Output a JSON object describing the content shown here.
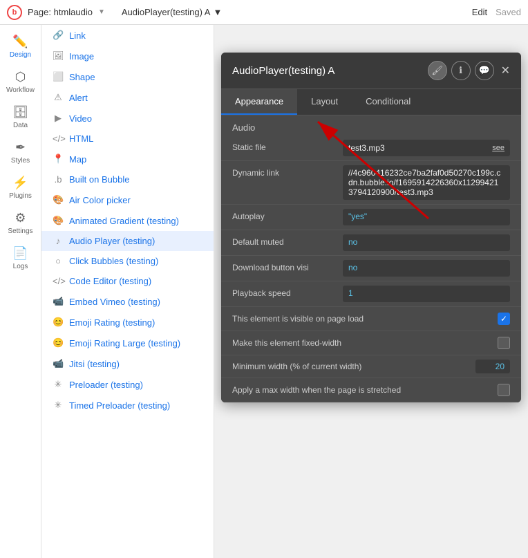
{
  "topbar": {
    "logo": "b",
    "page_label": "Page: htmlaudio",
    "dropdown_arrow": "▼",
    "element_label": "AudioPlayer(testing) A",
    "edit_label": "Edit",
    "saved_label": "Saved"
  },
  "icon_sidebar": {
    "items": [
      {
        "id": "design",
        "icon": "✏",
        "label": "Design",
        "active": true
      },
      {
        "id": "workflow",
        "icon": "⬡",
        "label": "Workflow",
        "active": false
      },
      {
        "id": "data",
        "icon": "🗄",
        "label": "Data",
        "active": false
      },
      {
        "id": "styles",
        "icon": "✒",
        "label": "Styles",
        "active": false
      },
      {
        "id": "plugins",
        "icon": "⚡",
        "label": "Plugins",
        "active": false
      },
      {
        "id": "settings",
        "icon": "⚙",
        "label": "Settings",
        "active": false
      },
      {
        "id": "logs",
        "icon": "📄",
        "label": "Logs",
        "active": false
      }
    ]
  },
  "elements_panel": {
    "items": [
      {
        "id": "link",
        "icon": "🔗",
        "label": "Link"
      },
      {
        "id": "image",
        "icon": "🖼",
        "label": "Image"
      },
      {
        "id": "shape",
        "icon": "⬜",
        "label": "Shape"
      },
      {
        "id": "alert",
        "icon": "⚠",
        "label": "Alert"
      },
      {
        "id": "video",
        "icon": "▶",
        "label": "Video"
      },
      {
        "id": "html",
        "icon": "</>",
        "label": "HTML"
      },
      {
        "id": "map",
        "icon": "📍",
        "label": "Map"
      },
      {
        "id": "built_on_bubble",
        "icon": ".b",
        "label": "Built on Bubble"
      },
      {
        "id": "air_color_picker",
        "icon": "🎨",
        "label": "Air Color picker"
      },
      {
        "id": "animated_gradient",
        "icon": "🎨",
        "label": "Animated Gradient (testing)"
      },
      {
        "id": "audio_player",
        "icon": "♪",
        "label": "Audio Player (testing)",
        "selected": true
      },
      {
        "id": "click_bubbles",
        "icon": "○",
        "label": "Click Bubbles (testing)"
      },
      {
        "id": "code_editor",
        "icon": "</>",
        "label": "Code Editor (testing)"
      },
      {
        "id": "embed_vimeo",
        "icon": "📹",
        "label": "Embed Vimeo (testing)"
      },
      {
        "id": "emoji_rating",
        "icon": "😊",
        "label": "Emoji Rating (testing)"
      },
      {
        "id": "emoji_rating_large",
        "icon": "😊",
        "label": "Emoji Rating Large (testing)"
      },
      {
        "id": "jitsi",
        "icon": "📹",
        "label": "Jitsi (testing)"
      },
      {
        "id": "preloader",
        "icon": "✳",
        "label": "Preloader (testing)"
      },
      {
        "id": "timed_preloader",
        "icon": "✳",
        "label": "Timed Preloader (testing)"
      }
    ]
  },
  "modal": {
    "title": "AudioPlayer(testing) A",
    "tabs": [
      "Appearance",
      "Layout",
      "Conditional"
    ],
    "active_tab": "Appearance",
    "section_label": "Audio",
    "properties": {
      "static_file_label": "Static file",
      "static_file_value": "test3.mp3",
      "static_file_see": "see",
      "dynamic_link_label": "Dynamic link",
      "dynamic_link_value": "//4c960416232ce7ba2faf0d50270c199c.cdn.bubble.io/f1695914226360x11299421 3794120900/test3.mp3",
      "autoplay_label": "Autoplay",
      "autoplay_value": "\"yes\"",
      "default_muted_label": "Default muted",
      "default_muted_value": "no",
      "download_button_label": "Download button visi",
      "download_button_value": "no",
      "playback_speed_label": "Playback speed",
      "playback_speed_value": "1",
      "visible_on_load_label": "This element is visible on page load",
      "fixed_width_label": "Make this element fixed-width",
      "min_width_label": "Minimum width (% of current width)",
      "min_width_value": "20",
      "max_width_label": "Apply a max width when the page is stretched"
    },
    "checkboxes": {
      "visible_on_load": true,
      "fixed_width": false,
      "max_width": false
    }
  }
}
